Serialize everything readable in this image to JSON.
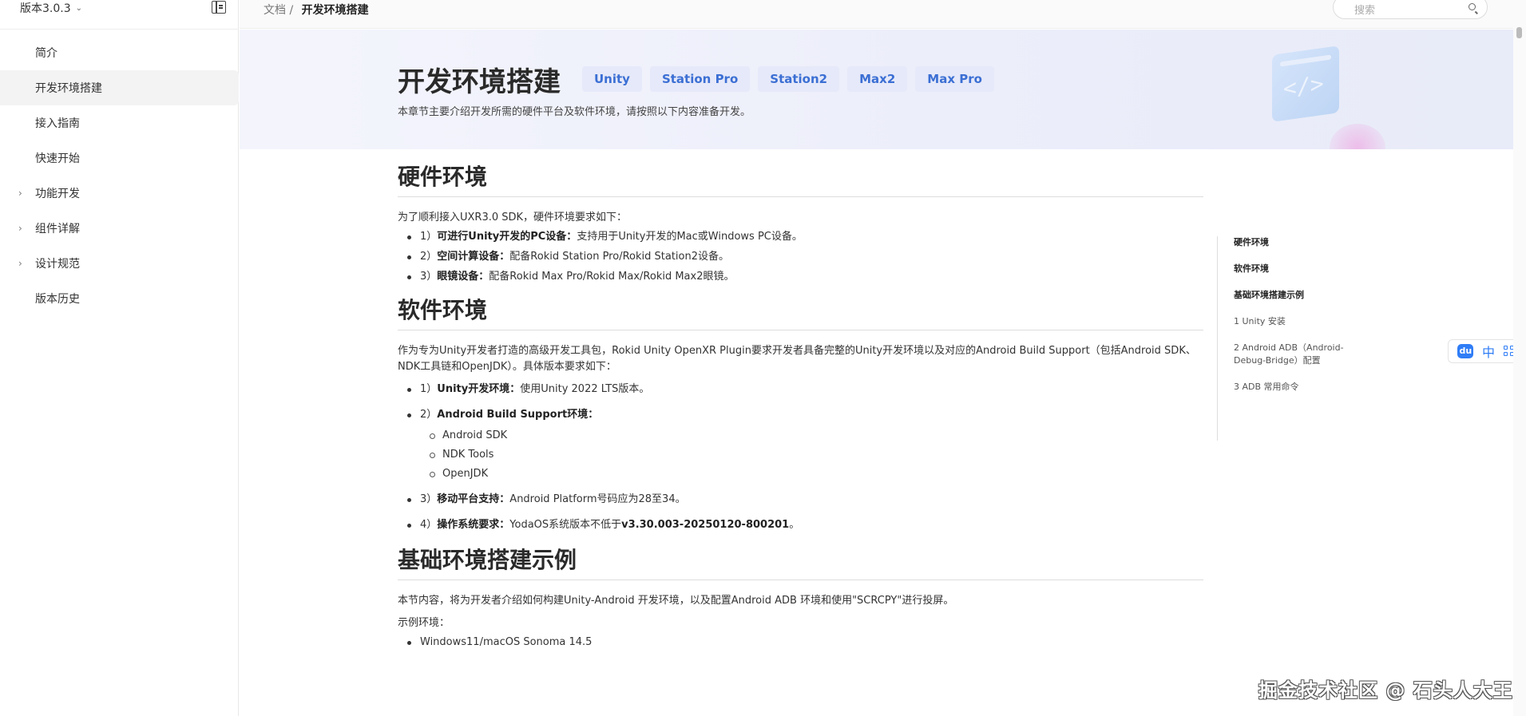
{
  "sidebar": {
    "version": "版本3.0.3",
    "items": [
      {
        "label": "简介",
        "expandable": false,
        "active": false
      },
      {
        "label": "开发环境搭建",
        "expandable": false,
        "active": true
      },
      {
        "label": "接入指南",
        "expandable": false,
        "active": false
      },
      {
        "label": "快速开始",
        "expandable": false,
        "active": false
      },
      {
        "label": "功能开发",
        "expandable": true,
        "active": false
      },
      {
        "label": "组件详解",
        "expandable": true,
        "active": false
      },
      {
        "label": "设计规范",
        "expandable": true,
        "active": false
      },
      {
        "label": "版本历史",
        "expandable": false,
        "active": false
      }
    ]
  },
  "topbar": {
    "crumb_root": "文档 /",
    "crumb_current": "开发环境搭建",
    "search_placeholder": "搜索"
  },
  "banner": {
    "title": "开发环境搭建",
    "tags": [
      "Unity",
      "Station Pro",
      "Station2",
      "Max2",
      "Max Pro"
    ],
    "subtitle": "本章节主要介绍开发所需的硬件平台及软件环境，请按照以下内容准备开发。",
    "illustration_symbol": "</>"
  },
  "content": {
    "hardware": {
      "heading": "硬件环境",
      "intro": "为了顺利接入UXR3.0 SDK，硬件环境要求如下：",
      "items": [
        {
          "prefix": "1）",
          "key": "可进行Unity开发的PC设备：",
          "text": "支持用于Unity开发的Mac或Windows PC设备。"
        },
        {
          "prefix": "2）",
          "key": "空间计算设备：",
          "text": "配备Rokid Station Pro/Rokid Station2设备。"
        },
        {
          "prefix": "3）",
          "key": "眼镜设备：",
          "text": "配备Rokid Max Pro/Rokid Max/Rokid Max2眼镜。"
        }
      ]
    },
    "software": {
      "heading": "软件环境",
      "intro": "作为专为Unity开发者打造的高级开发工具包，Rokid Unity OpenXR Plugin要求开发者具备完整的Unity开发环境以及对应的Android Build Support（包括Android SDK、NDK工具链和OpenJDK）。具体版本要求如下：",
      "item1": {
        "prefix": "1）",
        "key": "Unity开发环境：",
        "text": "使用Unity 2022 LTS版本。"
      },
      "item2": {
        "prefix": "2）",
        "key": "Android Build Support环境：",
        "text": "",
        "sub": [
          "Android SDK",
          "NDK Tools",
          "OpenJDK"
        ]
      },
      "item3": {
        "prefix": "3）",
        "key": "移动平台支持：",
        "text": "Android Platform号码应为28至34。"
      },
      "item4": {
        "prefix": "4）",
        "key": "操作系统要求：",
        "text": "YodaOS系统版本不低于",
        "bold_tail": "v3.30.003-20250120-800201",
        "tail": "。"
      }
    },
    "basic": {
      "heading": "基础环境搭建示例",
      "intro": "本节内容，将为开发者介绍如何构建Unity-Android 开发环境，以及配置Android ADB 环境和使用\"SCRCPY\"进行投屏。",
      "env_label": "示例环境：",
      "env_items": [
        "Windows11/macOS Sonoma 14.5"
      ]
    }
  },
  "toc": {
    "items": [
      {
        "label": "硬件环境",
        "bold": true
      },
      {
        "label": "软件环境",
        "bold": true
      },
      {
        "label": "基础环境搭建示例",
        "bold": true
      },
      {
        "label": "1 Unity 安装",
        "bold": false
      },
      {
        "label": "2 Android ADB（Android-Debug-Bridge）配置",
        "bold": false
      },
      {
        "label": "3 ADB 常用命令",
        "bold": false
      }
    ]
  },
  "float_toolbar": {
    "du_label": "du",
    "lang_label": "中"
  },
  "watermark": "掘金技术社区 @ 石头人大王"
}
